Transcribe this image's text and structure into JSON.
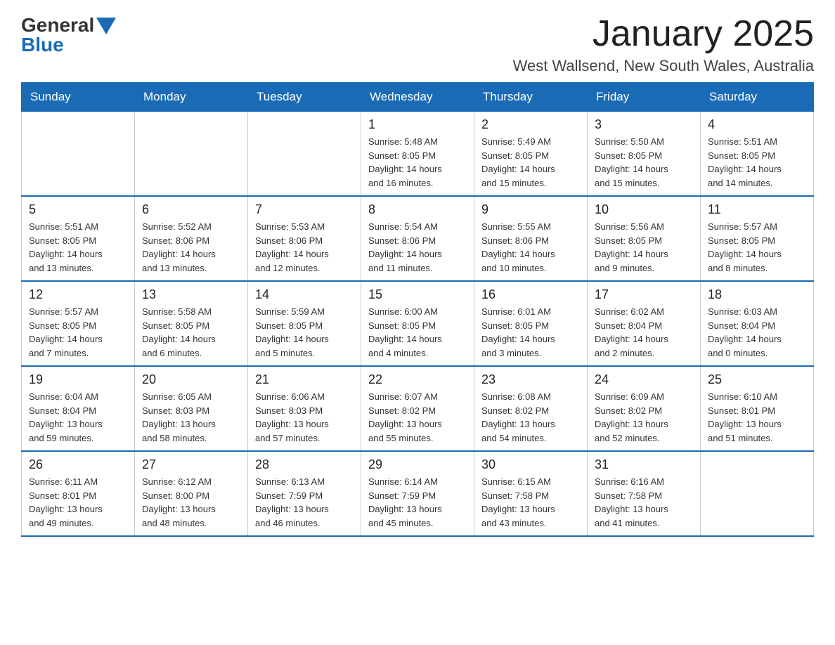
{
  "logo": {
    "general": "General",
    "blue": "Blue"
  },
  "header": {
    "month": "January 2025",
    "location": "West Wallsend, New South Wales, Australia"
  },
  "weekdays": [
    "Sunday",
    "Monday",
    "Tuesday",
    "Wednesday",
    "Thursday",
    "Friday",
    "Saturday"
  ],
  "weeks": [
    [
      {
        "day": "",
        "info": ""
      },
      {
        "day": "",
        "info": ""
      },
      {
        "day": "",
        "info": ""
      },
      {
        "day": "1",
        "info": "Sunrise: 5:48 AM\nSunset: 8:05 PM\nDaylight: 14 hours\nand 16 minutes."
      },
      {
        "day": "2",
        "info": "Sunrise: 5:49 AM\nSunset: 8:05 PM\nDaylight: 14 hours\nand 15 minutes."
      },
      {
        "day": "3",
        "info": "Sunrise: 5:50 AM\nSunset: 8:05 PM\nDaylight: 14 hours\nand 15 minutes."
      },
      {
        "day": "4",
        "info": "Sunrise: 5:51 AM\nSunset: 8:05 PM\nDaylight: 14 hours\nand 14 minutes."
      }
    ],
    [
      {
        "day": "5",
        "info": "Sunrise: 5:51 AM\nSunset: 8:05 PM\nDaylight: 14 hours\nand 13 minutes."
      },
      {
        "day": "6",
        "info": "Sunrise: 5:52 AM\nSunset: 8:06 PM\nDaylight: 14 hours\nand 13 minutes."
      },
      {
        "day": "7",
        "info": "Sunrise: 5:53 AM\nSunset: 8:06 PM\nDaylight: 14 hours\nand 12 minutes."
      },
      {
        "day": "8",
        "info": "Sunrise: 5:54 AM\nSunset: 8:06 PM\nDaylight: 14 hours\nand 11 minutes."
      },
      {
        "day": "9",
        "info": "Sunrise: 5:55 AM\nSunset: 8:06 PM\nDaylight: 14 hours\nand 10 minutes."
      },
      {
        "day": "10",
        "info": "Sunrise: 5:56 AM\nSunset: 8:05 PM\nDaylight: 14 hours\nand 9 minutes."
      },
      {
        "day": "11",
        "info": "Sunrise: 5:57 AM\nSunset: 8:05 PM\nDaylight: 14 hours\nand 8 minutes."
      }
    ],
    [
      {
        "day": "12",
        "info": "Sunrise: 5:57 AM\nSunset: 8:05 PM\nDaylight: 14 hours\nand 7 minutes."
      },
      {
        "day": "13",
        "info": "Sunrise: 5:58 AM\nSunset: 8:05 PM\nDaylight: 14 hours\nand 6 minutes."
      },
      {
        "day": "14",
        "info": "Sunrise: 5:59 AM\nSunset: 8:05 PM\nDaylight: 14 hours\nand 5 minutes."
      },
      {
        "day": "15",
        "info": "Sunrise: 6:00 AM\nSunset: 8:05 PM\nDaylight: 14 hours\nand 4 minutes."
      },
      {
        "day": "16",
        "info": "Sunrise: 6:01 AM\nSunset: 8:05 PM\nDaylight: 14 hours\nand 3 minutes."
      },
      {
        "day": "17",
        "info": "Sunrise: 6:02 AM\nSunset: 8:04 PM\nDaylight: 14 hours\nand 2 minutes."
      },
      {
        "day": "18",
        "info": "Sunrise: 6:03 AM\nSunset: 8:04 PM\nDaylight: 14 hours\nand 0 minutes."
      }
    ],
    [
      {
        "day": "19",
        "info": "Sunrise: 6:04 AM\nSunset: 8:04 PM\nDaylight: 13 hours\nand 59 minutes."
      },
      {
        "day": "20",
        "info": "Sunrise: 6:05 AM\nSunset: 8:03 PM\nDaylight: 13 hours\nand 58 minutes."
      },
      {
        "day": "21",
        "info": "Sunrise: 6:06 AM\nSunset: 8:03 PM\nDaylight: 13 hours\nand 57 minutes."
      },
      {
        "day": "22",
        "info": "Sunrise: 6:07 AM\nSunset: 8:02 PM\nDaylight: 13 hours\nand 55 minutes."
      },
      {
        "day": "23",
        "info": "Sunrise: 6:08 AM\nSunset: 8:02 PM\nDaylight: 13 hours\nand 54 minutes."
      },
      {
        "day": "24",
        "info": "Sunrise: 6:09 AM\nSunset: 8:02 PM\nDaylight: 13 hours\nand 52 minutes."
      },
      {
        "day": "25",
        "info": "Sunrise: 6:10 AM\nSunset: 8:01 PM\nDaylight: 13 hours\nand 51 minutes."
      }
    ],
    [
      {
        "day": "26",
        "info": "Sunrise: 6:11 AM\nSunset: 8:01 PM\nDaylight: 13 hours\nand 49 minutes."
      },
      {
        "day": "27",
        "info": "Sunrise: 6:12 AM\nSunset: 8:00 PM\nDaylight: 13 hours\nand 48 minutes."
      },
      {
        "day": "28",
        "info": "Sunrise: 6:13 AM\nSunset: 7:59 PM\nDaylight: 13 hours\nand 46 minutes."
      },
      {
        "day": "29",
        "info": "Sunrise: 6:14 AM\nSunset: 7:59 PM\nDaylight: 13 hours\nand 45 minutes."
      },
      {
        "day": "30",
        "info": "Sunrise: 6:15 AM\nSunset: 7:58 PM\nDaylight: 13 hours\nand 43 minutes."
      },
      {
        "day": "31",
        "info": "Sunrise: 6:16 AM\nSunset: 7:58 PM\nDaylight: 13 hours\nand 41 minutes."
      },
      {
        "day": "",
        "info": ""
      }
    ]
  ]
}
